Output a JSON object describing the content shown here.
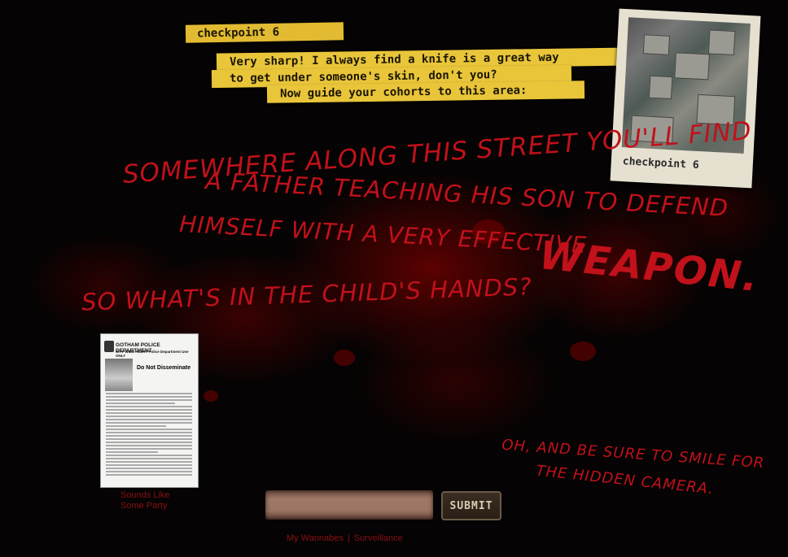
{
  "checkpoint": {
    "title": "checkpoint 6",
    "message_line1": "Very sharp!  I always find a knife is a great way",
    "message_line2": "to get under someone's skin, don't you?",
    "message_line3": "Now guide your cohorts to this area:"
  },
  "clue": {
    "line1": "Somewhere Along this Street you'll find",
    "line2": "a Father teaching his Son to defend",
    "line3": "himself with a Very effective",
    "weapon": "Weapon.",
    "line4": "So what's in the Child's Hands?"
  },
  "postscript": {
    "line1": "Oh, and be sure to Smile for",
    "line2": "the Hidden Camera."
  },
  "polaroid": {
    "caption": "checkpoint 6"
  },
  "flyer": {
    "department": "GOTHAM POLICE DEPARTMENT",
    "subtitle": "CITY WIDE ALERT Police Department Use ONLY",
    "notice": "Do Not Disseminate",
    "link_text_line1": "Sounds Like",
    "link_text_line2": "Some Party"
  },
  "form": {
    "answer_placeholder": "",
    "submit_label": "SUBMIT"
  },
  "footer": {
    "link1": "My Wannabes",
    "separator": "|",
    "link2": "Surveillance"
  },
  "colors": {
    "background": "#050303",
    "blood_red": "#c1111a",
    "tape_yellow": "#e9c53a",
    "link_red": "#8a0f12"
  }
}
